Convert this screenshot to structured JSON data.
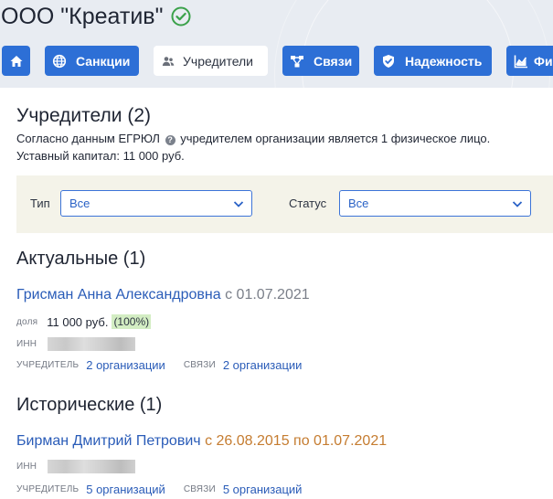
{
  "company": {
    "title": "ООО \"Креатив\""
  },
  "icons": {
    "verified": "check-circle-icon"
  },
  "colors": {
    "accent": "#2d6fd6",
    "link": "#2a5cb8",
    "historical": "#c57c30",
    "verified": "#3aa14a"
  },
  "tabs": [
    {
      "label": "",
      "icon": "home-icon"
    },
    {
      "label": "Санкции",
      "icon": "globe-icon"
    },
    {
      "label": "Учредители",
      "icon": "people-icon",
      "active": true
    },
    {
      "label": "Связи",
      "icon": "network-icon"
    },
    {
      "label": "Надежность",
      "icon": "shield-check-icon"
    },
    {
      "label": "Фи",
      "icon": "chart-icon"
    }
  ],
  "founders": {
    "title": "Учредители (2)",
    "desc_prefix": "Согласно данным ЕГРЮЛ",
    "desc_suffix": "учредителем организации является 1 физическое лицо.",
    "capital": "Уставный капитал: 11 000 руб."
  },
  "filters": {
    "type_label": "Тип",
    "type_value": "Все",
    "status_label": "Статус",
    "status_value": "Все"
  },
  "current": {
    "title": "Актуальные (1)",
    "name": "Грисман Анна Александровна",
    "since": "с 01.07.2021",
    "share_label": "доля",
    "share_value": "11 000 руб.",
    "share_pct": "(100%)",
    "inn_label": "ИНН",
    "founder_label": "УЧРЕДИТЕЛЬ",
    "founder_link": "2 организации",
    "links_label": "СВЯЗИ",
    "links_link": "2 организации"
  },
  "historical": {
    "title": "Исторические (1)",
    "name": "Бирман Дмитрий Петрович",
    "period": "с 26.08.2015 по 01.07.2021",
    "inn_label": "ИНН",
    "founder_label": "УЧРЕДИТЕЛЬ",
    "founder_link": "5 организаций",
    "links_label": "СВЯЗИ",
    "links_link": "5 организаций"
  }
}
